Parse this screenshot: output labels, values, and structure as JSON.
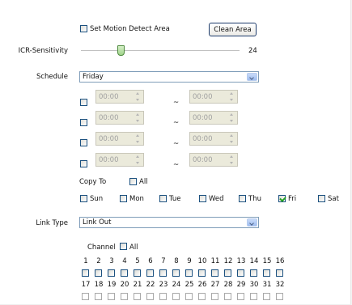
{
  "motion": {
    "label": "Set Motion Detect Area",
    "checked": false,
    "clean_button": "Clean Area"
  },
  "icr": {
    "label": "ICR-Sensitivity",
    "value": "24"
  },
  "schedule": {
    "label": "Schedule",
    "day_selected": "Friday",
    "periods": [
      {
        "start": "00:00",
        "end": "00:00"
      },
      {
        "start": "00:00",
        "end": "00:00"
      },
      {
        "start": "00:00",
        "end": "00:00"
      },
      {
        "start": "00:00",
        "end": "00:00"
      }
    ],
    "separator": "~",
    "copy_to_label": "Copy To",
    "all_label": "All",
    "days": [
      {
        "label": "Sun",
        "checked": false
      },
      {
        "label": "Mon",
        "checked": false
      },
      {
        "label": "Tue",
        "checked": false
      },
      {
        "label": "Wed",
        "checked": false
      },
      {
        "label": "Thu",
        "checked": false
      },
      {
        "label": "Fri",
        "checked": true
      },
      {
        "label": "Sat",
        "checked": false
      }
    ]
  },
  "link_type": {
    "label": "Link Type",
    "selected": "Link Out"
  },
  "channels": {
    "label": "Channel",
    "all_label": "All",
    "row1": [
      "1",
      "2",
      "3",
      "4",
      "5",
      "6",
      "7",
      "8",
      "9",
      "10",
      "11",
      "12",
      "13",
      "14",
      "15",
      "16"
    ],
    "row2": [
      "17",
      "18",
      "19",
      "20",
      "21",
      "22",
      "23",
      "24",
      "25",
      "26",
      "27",
      "28",
      "29",
      "30",
      "31",
      "32"
    ]
  },
  "colors": {
    "accent_check": "#21a121",
    "checkbox_border": "#1c5180",
    "slider_thumb": "#9fd38a"
  }
}
